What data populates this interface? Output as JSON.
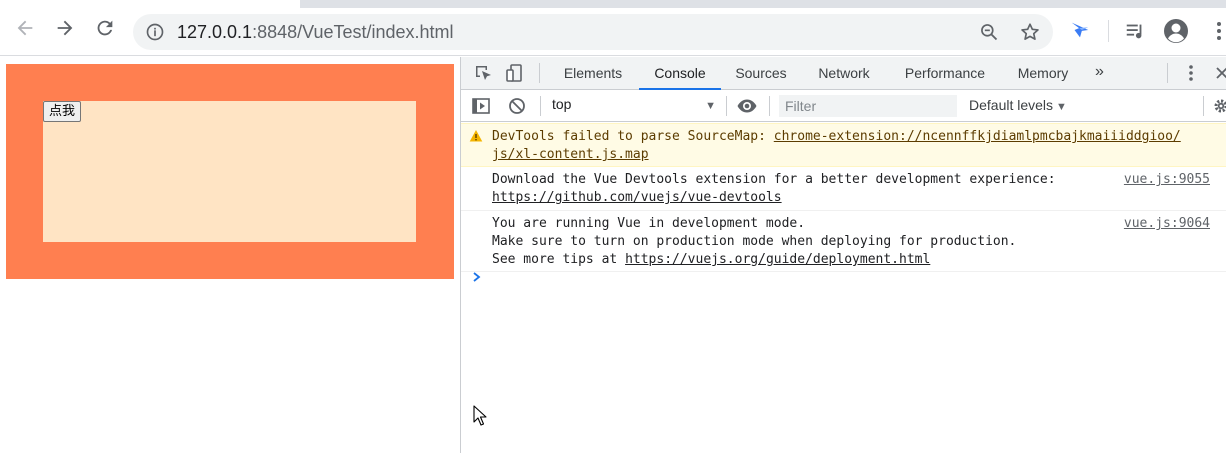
{
  "browser": {
    "url_host": "127.0.0.1",
    "url_rest": ":8848/VueTest/index.html",
    "icons": [
      "back-arrow-icon",
      "forward-arrow-icon",
      "reload-icon",
      "info-icon",
      "zoom-out-icon",
      "star-icon",
      "extension-icon",
      "media-icon",
      "profile-icon",
      "menu-icon"
    ]
  },
  "page": {
    "button_label": "点我",
    "outer_color": "#ff7f50",
    "inner_color": "#ffe4c4"
  },
  "devtools": {
    "tabs": [
      {
        "label": "Elements"
      },
      {
        "label": "Console"
      },
      {
        "label": "Sources"
      },
      {
        "label": "Network"
      },
      {
        "label": "Performance"
      },
      {
        "label": "Memory"
      }
    ],
    "more_tabs": "»",
    "active_tab": "Console",
    "context": "top",
    "filter_placeholder": "Filter",
    "levels": "Default levels",
    "accent": "#1a73e8",
    "messages": [
      {
        "type": "warning",
        "text1": "DevTools failed to parse SourceMap: ",
        "link1": "chrome-extension://ncennffkjdiamlpmcbajkmaiiiddgioo/",
        "link2": "js/xl-content.js.map"
      },
      {
        "type": "log",
        "text1": "Download the Vue Devtools extension for a better development experience:",
        "link1": "https://github.com/vuejs/vue-devtools",
        "source": "vue.js:9055"
      },
      {
        "type": "log",
        "text1": "You are running Vue in development mode.",
        "text2": "Make sure to turn on production mode when deploying for production.",
        "text3": "See more tips at ",
        "link1": "https://vuejs.org/guide/deployment.html",
        "source": "vue.js:9064"
      }
    ]
  }
}
